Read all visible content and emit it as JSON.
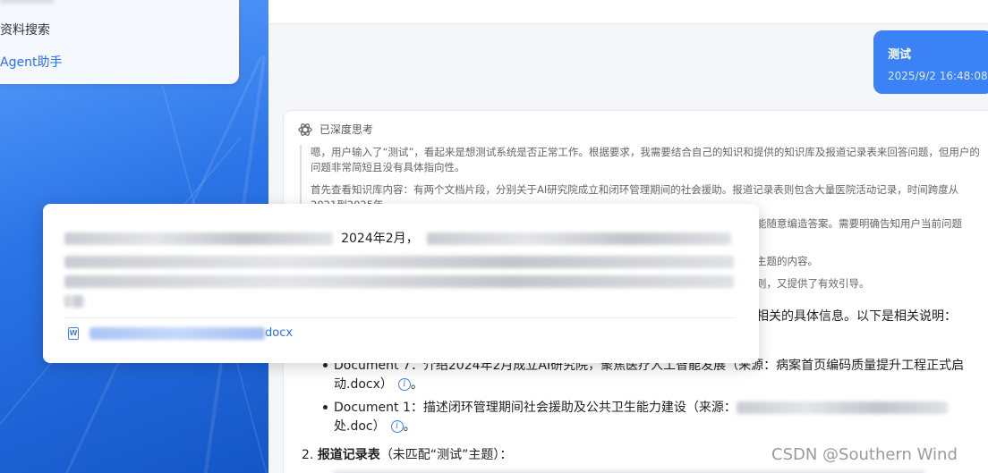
{
  "sidebar": {
    "items": [
      {
        "label": "资料搜索",
        "active": false
      },
      {
        "label": "Agent助手",
        "active": true
      }
    ]
  },
  "user_message": {
    "text": "测试",
    "time": "2025/9/2 16:48:08"
  },
  "thinking": {
    "header": "已深度思考",
    "paragraphs": [
      "嗯，用户输入了“测试”，看起来是想测试系统是否正常工作。根据要求，我需要结合自己的知识和提供的知识库及报道记录表来回答问题，但用户的问题非常简短且没有具体指向性。",
      "首先查看知识库内容：有两个文档片段，分别关于AI研究院成立和闭环管理期间的社会援助。报道记录表则包含大量医院活动记录，时间跨度从2021到2025年。"
    ],
    "partial_lines": [
      "能随意编造答案。需要明确告知用户当前问题",
      "主题的内容。",
      "则，又提供了有效引导。"
    ]
  },
  "answer": {
    "intro_tail": "相关的具体信息。以下是相关说明：",
    "doc_items": [
      {
        "line1": "Document 7：介绍2024年2月成立AI研究院，聚焦医疗人工智能发展（来源：病案首页编码质量提升工程正式启",
        "line2": "动.docx）"
      },
      {
        "line1": "Document 1：描述闭环管理期间社会援助及公共卫生能力建设（来源：",
        "line2": "处.doc）"
      }
    ],
    "section2": {
      "number": "2.",
      "title": "报道记录表",
      "note": "（未匹配“测试”主题）："
    }
  },
  "popup": {
    "visible_text": "2024年2月，",
    "link_suffix": "docx",
    "file_icon": "word-file-icon"
  },
  "watermark": "CSDN @Southern Wind",
  "colors": {
    "accent": "#3b82f6",
    "sidebar_blue": "#2b74e6"
  }
}
